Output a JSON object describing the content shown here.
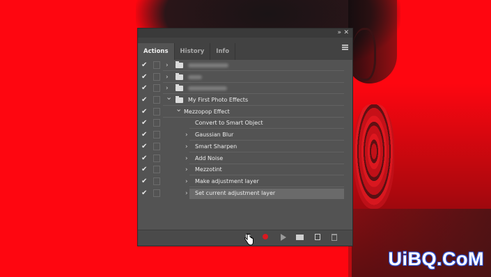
{
  "panel": {
    "collapse_icon": "double-chevron-icon",
    "close_icon": "close-icon",
    "tabs": [
      {
        "label": "Actions",
        "active": true
      },
      {
        "label": "History",
        "active": false
      },
      {
        "label": "Info",
        "active": false
      }
    ],
    "menu_icon": "hamburger-menu-icon"
  },
  "actions": {
    "rows": [
      {
        "type": "set",
        "label": "",
        "blurred": true,
        "expanded": false
      },
      {
        "type": "set",
        "label": "",
        "blurred": true,
        "expanded": false
      },
      {
        "type": "set",
        "label": "",
        "blurred": true,
        "expanded": false
      },
      {
        "type": "set",
        "label": "My First Photo Effects",
        "expanded": true
      },
      {
        "type": "action",
        "label": "Mezzopop Effect",
        "expanded": true
      },
      {
        "type": "step",
        "label": "Convert to Smart Object",
        "has_arrow": false
      },
      {
        "type": "step",
        "label": "Gaussian Blur",
        "has_arrow": true
      },
      {
        "type": "step",
        "label": "Smart Sharpen",
        "has_arrow": true
      },
      {
        "type": "step",
        "label": "Add Noise",
        "has_arrow": true
      },
      {
        "type": "step",
        "label": "Mezzotint",
        "has_arrow": true
      },
      {
        "type": "step",
        "label": "Make adjustment layer",
        "has_arrow": true
      },
      {
        "type": "step",
        "label": "Set current adjustment layer",
        "has_arrow": true,
        "selected": true
      }
    ]
  },
  "bottombar": {
    "stop_icon": "stop-recording-icon",
    "record_icon": "record-icon",
    "play_icon": "play-selection-icon",
    "new_set_icon": "new-set-folder-icon",
    "new_action_icon": "new-action-icon",
    "delete_icon": "trash-icon"
  },
  "colors": {
    "accent_record": "#d91920",
    "background": "#fe0610"
  },
  "watermark": "UiBQ.CoM"
}
